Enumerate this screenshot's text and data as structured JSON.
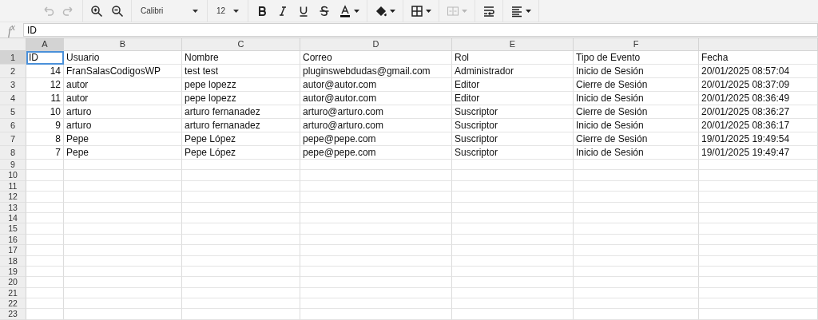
{
  "toolbar": {
    "groups": [
      [
        {
          "kind": "undo",
          "disabled": true
        },
        {
          "kind": "redo",
          "disabled": true
        }
      ],
      [
        {
          "kind": "zoom-in",
          "disabled": false
        },
        {
          "kind": "zoom-out",
          "disabled": false
        }
      ],
      [
        {
          "kind": "font",
          "label": "Calibri",
          "disabled": false
        }
      ],
      [
        {
          "kind": "size",
          "label": "12",
          "disabled": false
        }
      ],
      [
        {
          "kind": "bold",
          "disabled": false
        },
        {
          "kind": "italic",
          "disabled": false
        },
        {
          "kind": "underline",
          "disabled": false
        },
        {
          "kind": "strike",
          "disabled": false
        },
        {
          "kind": "text-color",
          "disabled": false
        }
      ],
      [
        {
          "kind": "fill-color",
          "disabled": false
        }
      ],
      [
        {
          "kind": "borders",
          "disabled": false
        }
      ],
      [
        {
          "kind": "merge",
          "disabled": true
        }
      ],
      [
        {
          "kind": "wrap",
          "disabled": false
        }
      ],
      [
        {
          "kind": "align",
          "disabled": false
        }
      ]
    ]
  },
  "formula_bar": {
    "label": "f$^{x}$",
    "value": "ID"
  },
  "sheet": {
    "columns": [
      {
        "letter": "A",
        "selected": true
      },
      {
        "letter": "B",
        "selected": false
      },
      {
        "letter": "C",
        "selected": false
      },
      {
        "letter": "D",
        "selected": false
      },
      {
        "letter": "E",
        "selected": false
      },
      {
        "letter": "F",
        "selected": false
      },
      {
        "selected": false
      }
    ],
    "rows": [
      {
        "number": "1",
        "selected": true,
        "cells": [
          {
            "text": "ID",
            "kind": "text",
            "selected": true
          },
          {
            "text": "Usuario",
            "kind": "text",
            "selected": false
          },
          {
            "text": "Nombre",
            "kind": "text",
            "selected": false
          },
          {
            "text": "Correo",
            "kind": "text",
            "selected": false
          },
          {
            "text": "Rol",
            "kind": "text",
            "selected": false
          },
          {
            "text": "Tipo de Evento",
            "kind": "text",
            "selected": false
          },
          {
            "text": "Fecha",
            "kind": "text",
            "selected": false
          }
        ]
      },
      {
        "number": "2",
        "selected": false,
        "cells": [
          {
            "text": "14",
            "kind": "number",
            "selected": false
          },
          {
            "text": "FranSalasCodigosWP",
            "kind": "text",
            "selected": false
          },
          {
            "text": "test test",
            "kind": "text",
            "selected": false
          },
          {
            "text": "pluginswebdudas@gmail.com",
            "kind": "text",
            "selected": false
          },
          {
            "text": "Administrador",
            "kind": "text",
            "selected": false
          },
          {
            "text": "Inicio de Sesión",
            "kind": "text",
            "selected": false
          },
          {
            "text": "20/01/2025 08:57:04",
            "kind": "text",
            "selected": false
          }
        ]
      },
      {
        "number": "3",
        "selected": false,
        "cells": [
          {
            "text": "12",
            "kind": "number",
            "selected": false
          },
          {
            "text": "autor",
            "kind": "text",
            "selected": false
          },
          {
            "text": "pepe lopezz",
            "kind": "text",
            "selected": false
          },
          {
            "text": "autor@autor.com",
            "kind": "text",
            "selected": false
          },
          {
            "text": "Editor",
            "kind": "text",
            "selected": false
          },
          {
            "text": "Cierre de Sesión",
            "kind": "text",
            "selected": false
          },
          {
            "text": "20/01/2025 08:37:09",
            "kind": "text",
            "selected": false
          }
        ]
      },
      {
        "number": "4",
        "selected": false,
        "cells": [
          {
            "text": "11",
            "kind": "number",
            "selected": false
          },
          {
            "text": "autor",
            "kind": "text",
            "selected": false
          },
          {
            "text": "pepe lopezz",
            "kind": "text",
            "selected": false
          },
          {
            "text": "autor@autor.com",
            "kind": "text",
            "selected": false
          },
          {
            "text": "Editor",
            "kind": "text",
            "selected": false
          },
          {
            "text": "Inicio de Sesión",
            "kind": "text",
            "selected": false
          },
          {
            "text": "20/01/2025 08:36:49",
            "kind": "text",
            "selected": false
          }
        ]
      },
      {
        "number": "5",
        "selected": false,
        "cells": [
          {
            "text": "10",
            "kind": "number",
            "selected": false
          },
          {
            "text": "arturo",
            "kind": "text",
            "selected": false
          },
          {
            "text": "arturo fernanadez",
            "kind": "text",
            "selected": false
          },
          {
            "text": "arturo@arturo.com",
            "kind": "text",
            "selected": false
          },
          {
            "text": "Suscriptor",
            "kind": "text",
            "selected": false
          },
          {
            "text": "Cierre de Sesión",
            "kind": "text",
            "selected": false
          },
          {
            "text": "20/01/2025 08:36:27",
            "kind": "text",
            "selected": false
          }
        ]
      },
      {
        "number": "6",
        "selected": false,
        "cells": [
          {
            "text": "9",
            "kind": "number",
            "selected": false
          },
          {
            "text": "arturo",
            "kind": "text",
            "selected": false
          },
          {
            "text": "arturo fernanadez",
            "kind": "text",
            "selected": false
          },
          {
            "text": "arturo@arturo.com",
            "kind": "text",
            "selected": false
          },
          {
            "text": "Suscriptor",
            "kind": "text",
            "selected": false
          },
          {
            "text": "Inicio de Sesión",
            "kind": "text",
            "selected": false
          },
          {
            "text": "20/01/2025 08:36:17",
            "kind": "text",
            "selected": false
          }
        ]
      },
      {
        "number": "7",
        "selected": false,
        "cells": [
          {
            "text": "8",
            "kind": "number",
            "selected": false
          },
          {
            "text": "Pepe",
            "kind": "text",
            "selected": false
          },
          {
            "text": "Pepe López",
            "kind": "text",
            "selected": false
          },
          {
            "text": "pepe@pepe.com",
            "kind": "text",
            "selected": false
          },
          {
            "text": "Suscriptor",
            "kind": "text",
            "selected": false
          },
          {
            "text": "Cierre de Sesión",
            "kind": "text",
            "selected": false
          },
          {
            "text": "19/01/2025 19:49:54",
            "kind": "text",
            "selected": false
          }
        ]
      },
      {
        "number": "8",
        "selected": false,
        "cells": [
          {
            "text": "7",
            "kind": "number",
            "selected": false
          },
          {
            "text": "Pepe",
            "kind": "text",
            "selected": false
          },
          {
            "text": "Pepe López",
            "kind": "text",
            "selected": false
          },
          {
            "text": "pepe@pepe.com",
            "kind": "text",
            "selected": false
          },
          {
            "text": "Suscriptor",
            "kind": "text",
            "selected": false
          },
          {
            "text": "Inicio de Sesión",
            "kind": "text",
            "selected": false
          },
          {
            "text": "19/01/2025 19:49:47",
            "kind": "text",
            "selected": false
          }
        ]
      },
      {
        "number": "9",
        "selected": false
      },
      {
        "number": "10",
        "selected": false
      },
      {
        "number": "11",
        "selected": false
      },
      {
        "number": "12",
        "selected": false
      },
      {
        "number": "13",
        "selected": false
      },
      {
        "number": "14",
        "selected": false
      },
      {
        "number": "15",
        "selected": false
      },
      {
        "number": "16",
        "selected": false
      },
      {
        "number": "17",
        "selected": false
      },
      {
        "number": "18",
        "selected": false
      },
      {
        "number": "19",
        "selected": false
      },
      {
        "number": "20",
        "selected": false
      },
      {
        "number": "21",
        "selected": false
      },
      {
        "number": "22",
        "selected": false
      },
      {
        "number": "23",
        "selected": false
      }
    ]
  }
}
